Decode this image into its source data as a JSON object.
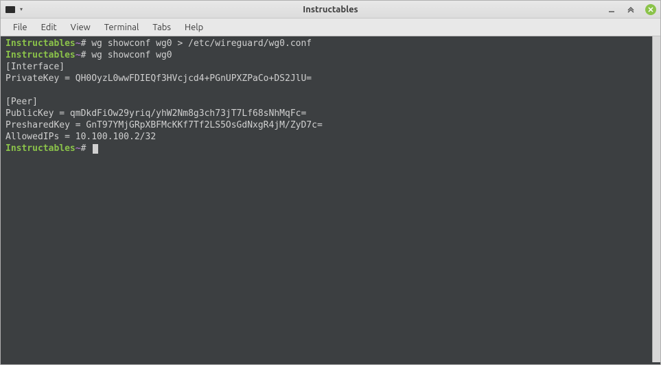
{
  "window": {
    "title": "Instructables"
  },
  "menubar": {
    "items": [
      "File",
      "Edit",
      "View",
      "Terminal",
      "Tabs",
      "Help"
    ]
  },
  "terminal": {
    "prompt_host": "Instructables",
    "prompt_sep": "~",
    "prompt_symbol": "#",
    "lines": [
      {
        "type": "cmd",
        "text": "wg showconf wg0 > /etc/wireguard/wg0.conf"
      },
      {
        "type": "cmd",
        "text": "wg showconf wg0"
      },
      {
        "type": "out",
        "text": "[Interface]"
      },
      {
        "type": "out",
        "text": "PrivateKey = QH0OyzL0wwFDIEQf3HVcjcd4+PGnUPXZPaCo+DS2JlU="
      },
      {
        "type": "out",
        "text": ""
      },
      {
        "type": "out",
        "text": "[Peer]"
      },
      {
        "type": "out",
        "text": "PublicKey = qmDkdFiOw29yriq/yhW2Nm8g3ch73jT7Lf68sNhMqFc="
      },
      {
        "type": "out",
        "text": "PresharedKey = GnT97YMjGRpXBFMcKKf7Tf2LS5OsGdNxgR4jM/ZyD7c="
      },
      {
        "type": "out",
        "text": "AllowedIPs = 10.100.100.2/32"
      },
      {
        "type": "prompt",
        "text": ""
      }
    ]
  }
}
